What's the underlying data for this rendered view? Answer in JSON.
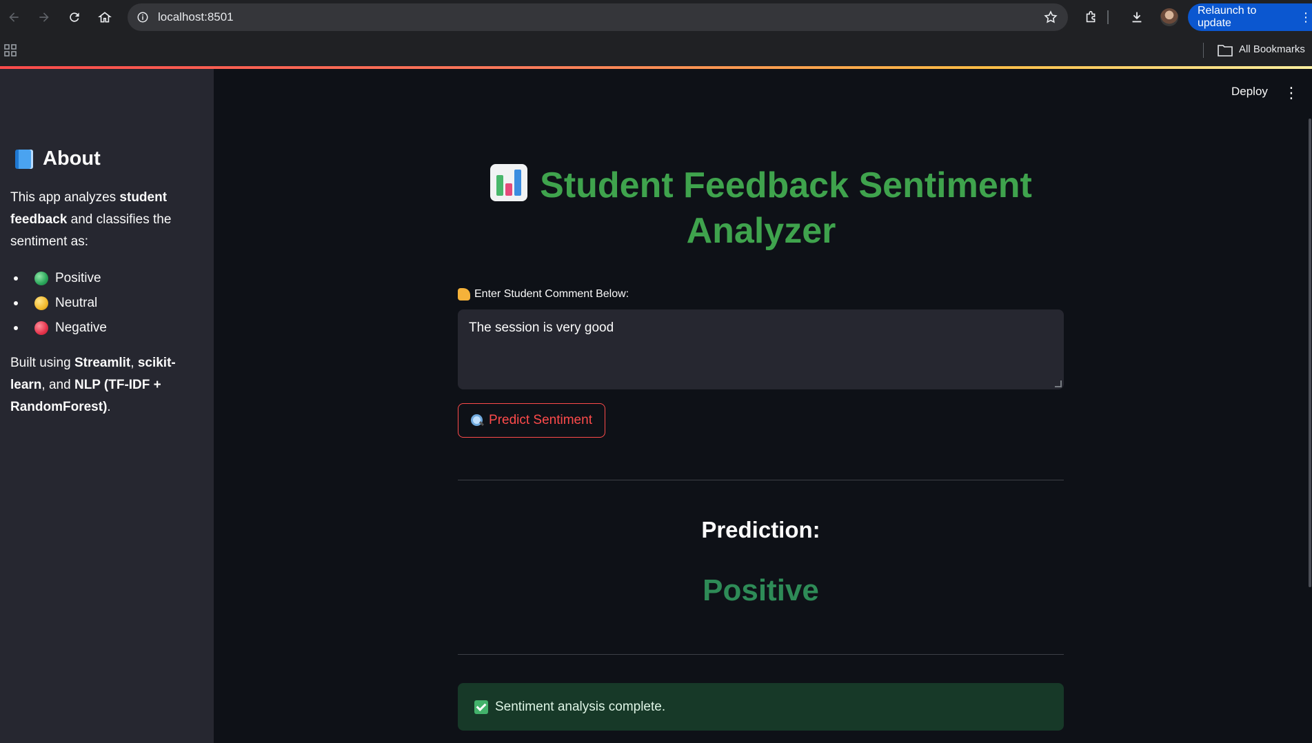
{
  "browser": {
    "url": "localhost:8501",
    "relaunch_label": "Relaunch to update",
    "bookmarks_label": "All Bookmarks"
  },
  "toolbar": {
    "deploy_label": "Deploy"
  },
  "sidebar": {
    "title": "About",
    "intro_1": "This app analyzes ",
    "intro_bold_1": "student feedback",
    "intro_2": " and classifies the sentiment as:",
    "items": [
      {
        "label": "Positive",
        "color": "green"
      },
      {
        "label": "Neutral",
        "color": "yellow"
      },
      {
        "label": "Negative",
        "color": "red"
      }
    ],
    "built_1": "Built using ",
    "built_bold_1": "Streamlit",
    "built_2": ", ",
    "built_bold_2": "scikit-learn",
    "built_3": ", and ",
    "built_bold_3": "NLP (TF-IDF + RandomForest)",
    "built_4": "."
  },
  "main": {
    "title": "Student Feedback Sentiment Analyzer",
    "input_label": "Enter Student Comment Below:",
    "comment_value": "The session is very good",
    "predict_button": "Predict Sentiment",
    "prediction_label": "Prediction:",
    "prediction_value": "Positive",
    "status_message": "Sentiment analysis complete."
  },
  "colors": {
    "accent": "#ff4b4b",
    "title_green": "#3fa34d",
    "positive_green": "#2e8b57",
    "background": "#0e1117",
    "sidebar": "#262730",
    "success_bg": "#173928"
  }
}
